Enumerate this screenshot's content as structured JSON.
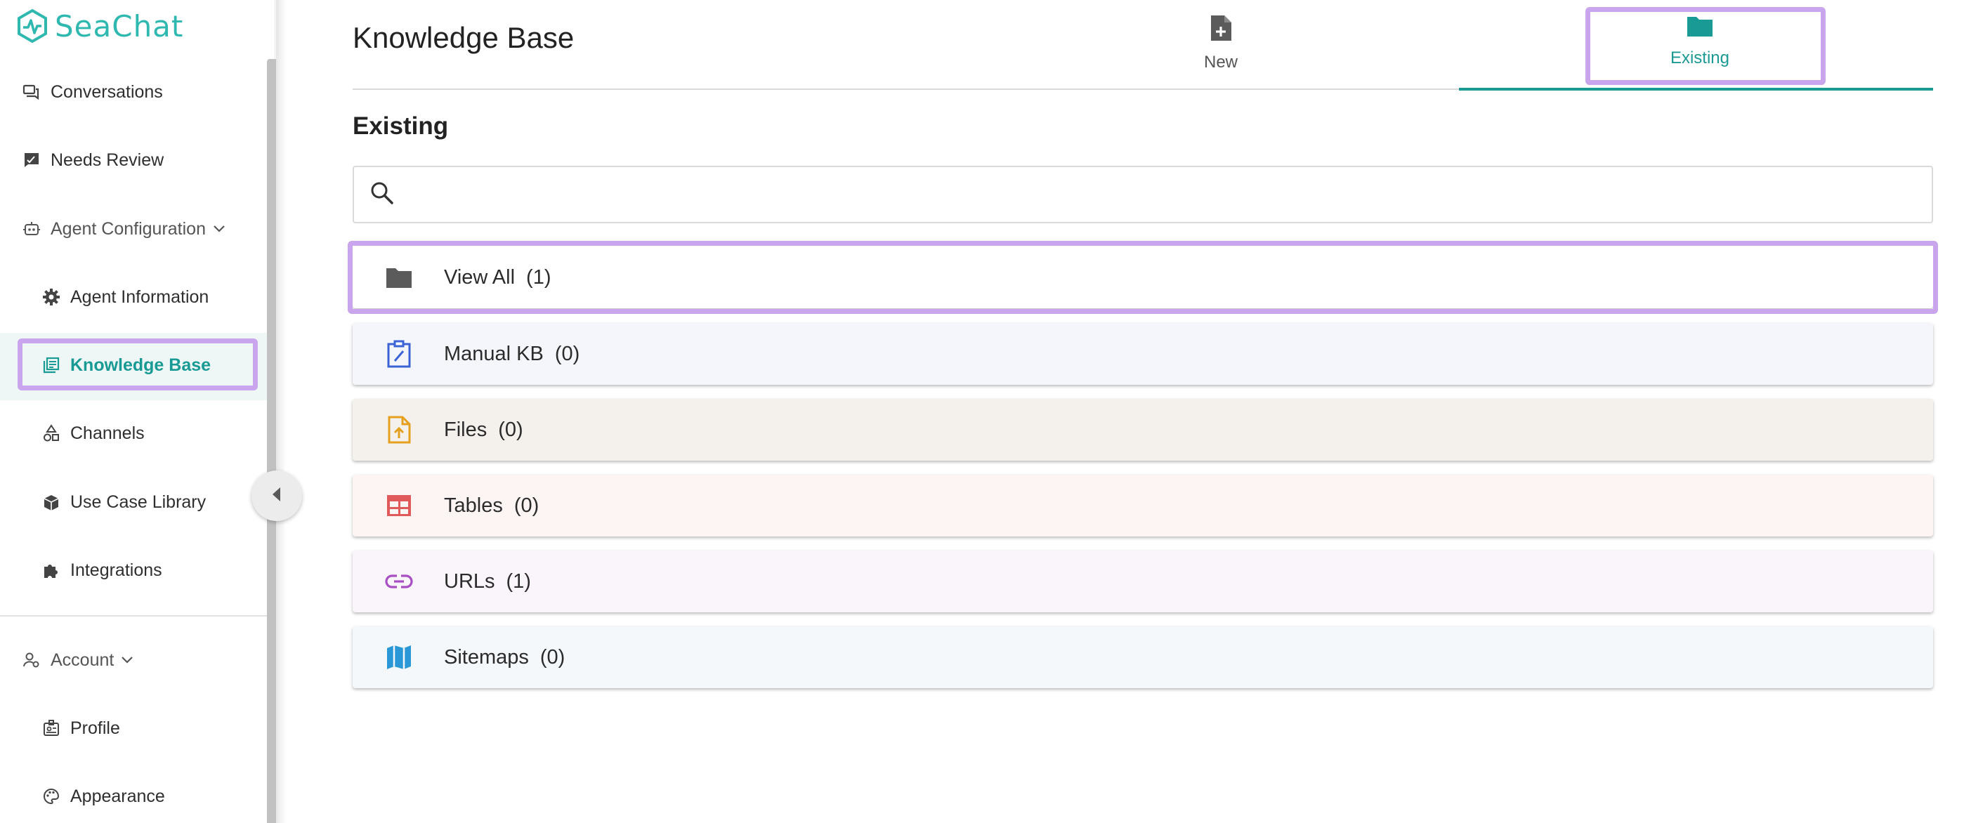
{
  "app": {
    "name": "SeaChat"
  },
  "sidebar": {
    "items": [
      {
        "label": "Conversations",
        "icon": "chat-bubbles-icon"
      },
      {
        "label": "Needs Review",
        "icon": "review-icon"
      },
      {
        "label": "Agent Configuration",
        "icon": "robot-icon"
      },
      {
        "label": "Agent Information",
        "icon": "gear-icon"
      },
      {
        "label": "Knowledge Base",
        "icon": "library-icon",
        "active": true
      },
      {
        "label": "Channels",
        "icon": "shapes-icon"
      },
      {
        "label": "Use Case Library",
        "icon": "box-icon"
      },
      {
        "label": "Integrations",
        "icon": "puzzle-icon"
      },
      {
        "label": "Account",
        "icon": "user-cog-icon"
      },
      {
        "label": "Profile",
        "icon": "id-badge-icon"
      },
      {
        "label": "Appearance",
        "icon": "palette-icon"
      }
    ]
  },
  "main": {
    "title": "Knowledge Base",
    "tabs": [
      {
        "label": "New",
        "icon": "file-plus-icon"
      },
      {
        "label": "Existing",
        "icon": "folder-icon",
        "active": true
      }
    ],
    "section_title": "Existing",
    "search": {
      "placeholder": ""
    },
    "kb_sources": [
      {
        "label": "View All",
        "count": "(1)",
        "icon": "folder-icon",
        "color": "#5b5b5b",
        "bg": "#ffffff"
      },
      {
        "label": "Manual KB",
        "count": "(0)",
        "icon": "clipboard-edit-icon",
        "color": "#3b63d6",
        "bg": "#f4f6fb"
      },
      {
        "label": "Files",
        "count": "(0)",
        "icon": "file-upload-icon",
        "color": "#e6a01f",
        "bg": "#f4f1ec"
      },
      {
        "label": "Tables",
        "count": "(0)",
        "icon": "table-icon",
        "color": "#e05a5a",
        "bg": "#fdf4f4"
      },
      {
        "label": "URLs",
        "count": "(1)",
        "icon": "link-icon",
        "color": "#a84fc4",
        "bg": "#faf4fb"
      },
      {
        "label": "Sitemaps",
        "count": "(0)",
        "icon": "map-icon",
        "color": "#2a97d6",
        "bg": "#f4f8fb"
      }
    ]
  },
  "colors": {
    "accent": "#1a9a94",
    "highlight": "#c9a5ee"
  }
}
